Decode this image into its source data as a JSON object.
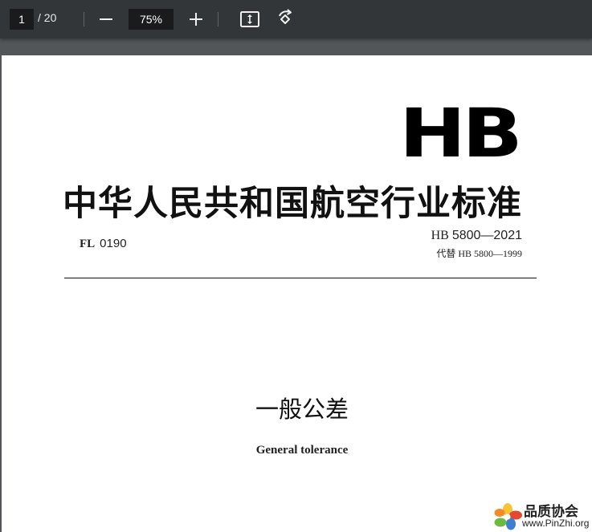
{
  "toolbar": {
    "page_input_value": "1",
    "page_total": "/ 20",
    "zoom_value": "75%",
    "icons": [
      "minus-icon",
      "plus-icon",
      "fit-page-icon",
      "rotate-icon"
    ]
  },
  "document": {
    "logo_text": "HB",
    "org_title": "中华人民共和国航空行业标准",
    "class_prefix": "FL",
    "class_code": "0190",
    "std_prefix": "HB",
    "std_number": "5800—2021",
    "replaces": "代替 HB 5800—1999",
    "title_cn": "一般公差",
    "title_en": "General tolerance"
  },
  "watermark": {
    "name": "品质协会",
    "url": "www.PinZhi.org"
  }
}
